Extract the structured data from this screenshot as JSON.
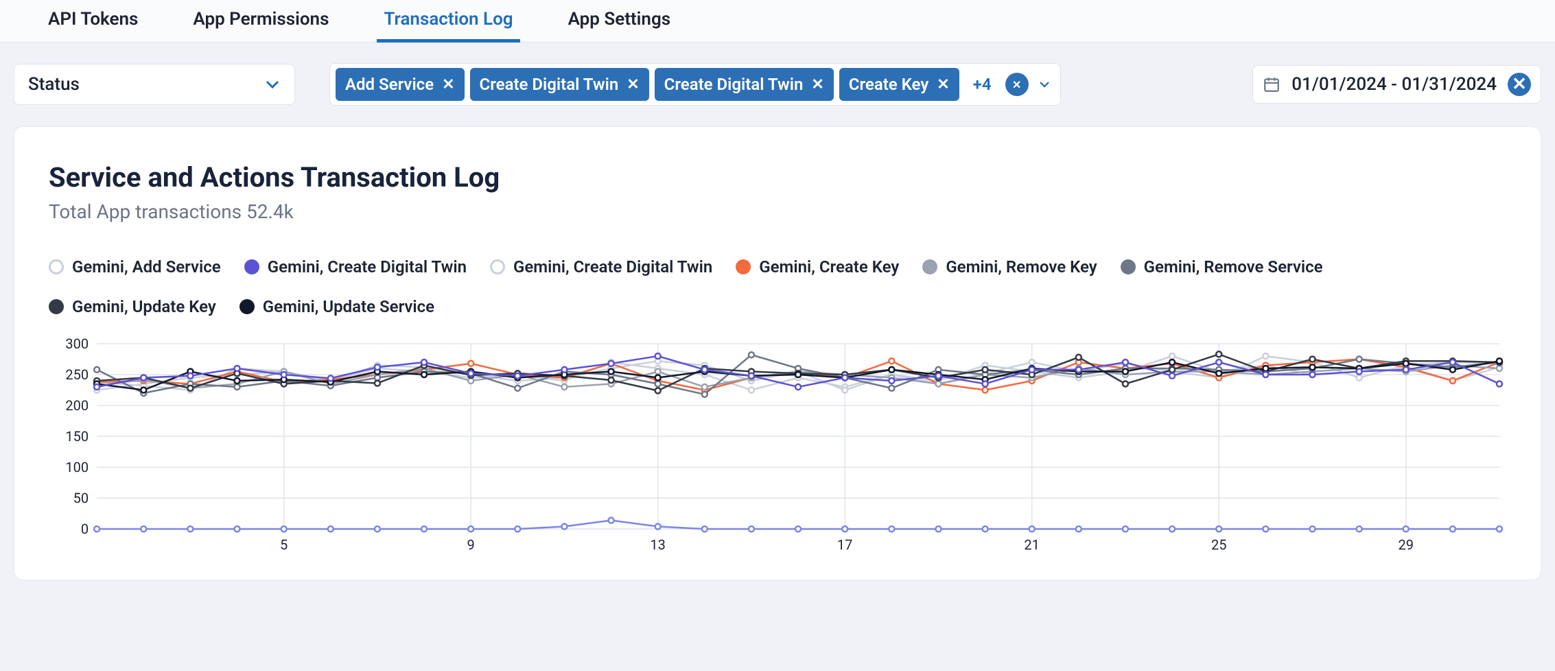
{
  "tabs": [
    {
      "label": "API Tokens",
      "active": false
    },
    {
      "label": "App Permissions",
      "active": false
    },
    {
      "label": "Transaction Log",
      "active": true
    },
    {
      "label": "App Settings",
      "active": false
    }
  ],
  "status_filter": {
    "label": "Status"
  },
  "chips": [
    {
      "label": "Add Service"
    },
    {
      "label": "Create Digital Twin"
    },
    {
      "label": "Create Digital Twin"
    },
    {
      "label": "Create Key"
    }
  ],
  "chips_more": "+4",
  "date_range": {
    "label": "01/01/2024 - 01/31/2024"
  },
  "card": {
    "title": "Service and Actions Transaction Log",
    "subtitle": "Total App transactions 52.4k"
  },
  "legend": [
    {
      "label": "Gemini, Add Service",
      "color": "#c9cfdb",
      "filled": false
    },
    {
      "label": "Gemini, Create Digital Twin",
      "color": "#5b52d6",
      "filled": true
    },
    {
      "label": "Gemini, Create Digital Twin",
      "color": "#c9cfdb",
      "filled": false
    },
    {
      "label": "Gemini, Create Key",
      "color": "#f26a3d",
      "filled": true
    },
    {
      "label": "Gemini, Remove Key",
      "color": "#9aa2b1",
      "filled": true
    },
    {
      "label": "Gemini, Remove Service",
      "color": "#6e7787",
      "filled": true
    },
    {
      "label": "Gemini, Update Key",
      "color": "#343a46",
      "filled": true
    },
    {
      "label": "Gemini, Update Service",
      "color": "#12182b",
      "filled": true
    }
  ],
  "chart_data": {
    "type": "line",
    "xlabel": "",
    "ylabel": "",
    "ylim": [
      0,
      300
    ],
    "y_ticks": [
      0,
      50,
      100,
      150,
      200,
      250,
      300
    ],
    "x_tick_labels": [
      "5",
      "9",
      "13",
      "17",
      "21",
      "25",
      "29"
    ],
    "x_tick_positions": [
      5,
      9,
      13,
      17,
      21,
      25,
      29
    ],
    "x": [
      1,
      2,
      3,
      4,
      5,
      6,
      7,
      8,
      9,
      10,
      11,
      12,
      13,
      14,
      15,
      16,
      17,
      18,
      19,
      20,
      21,
      22,
      23,
      24,
      25,
      26,
      27,
      28,
      29,
      30,
      31
    ],
    "series": [
      {
        "name": "Gemini, Add Service",
        "color": "#c9cfdb",
        "values": [
          225,
          235,
          245,
          250,
          255,
          240,
          260,
          255,
          245,
          250,
          240,
          270,
          260,
          250,
          225,
          245,
          230,
          250,
          240,
          265,
          255,
          245,
          255,
          280,
          255,
          265,
          250,
          255,
          260,
          240,
          262
        ]
      },
      {
        "name": "Gemini, Create Digital Twin (flat)",
        "color": "#7c86e6",
        "values": [
          0,
          0,
          0,
          0,
          0,
          0,
          0,
          0,
          0,
          0,
          4,
          14,
          4,
          0,
          0,
          0,
          0,
          0,
          0,
          0,
          0,
          0,
          0,
          0,
          0,
          0,
          0,
          0,
          0,
          0,
          0
        ]
      },
      {
        "name": "Gemini, Create Digital Twin (2)",
        "color": "#c9cfdb",
        "values": [
          238,
          232,
          225,
          260,
          255,
          240,
          265,
          262,
          250,
          240,
          245,
          260,
          272,
          265,
          240,
          255,
          225,
          250,
          235,
          252,
          270,
          255,
          268,
          255,
          245,
          280,
          270,
          245,
          265,
          270,
          268
        ]
      },
      {
        "name": "Gemini, Create Key",
        "color": "#f26a3d",
        "values": [
          238,
          240,
          235,
          255,
          238,
          242,
          250,
          258,
          268,
          250,
          245,
          268,
          240,
          225,
          245,
          255,
          245,
          272,
          235,
          225,
          240,
          270,
          260,
          268,
          245,
          265,
          270,
          275,
          262,
          240,
          270
        ]
      },
      {
        "name": "Gemini, Remove Key",
        "color": "#9aa2b1",
        "values": [
          232,
          242,
          228,
          235,
          255,
          235,
          250,
          260,
          240,
          250,
          230,
          235,
          255,
          230,
          245,
          255,
          250,
          245,
          235,
          250,
          245,
          260,
          250,
          255,
          255,
          250,
          255,
          260,
          255,
          265,
          260
        ]
      },
      {
        "name": "Gemini, Remove Service",
        "color": "#6e7787",
        "values": [
          258,
          220,
          235,
          230,
          240,
          232,
          245,
          255,
          252,
          228,
          255,
          250,
          235,
          218,
          282,
          260,
          245,
          228,
          258,
          250,
          258,
          250,
          260,
          260,
          258,
          255,
          260,
          275,
          268,
          262,
          270
        ]
      },
      {
        "name": "Gemini, Update Key",
        "color": "#343a46",
        "values": [
          240,
          245,
          228,
          252,
          235,
          240,
          236,
          265,
          249,
          252,
          248,
          241,
          224,
          260,
          255,
          252,
          250,
          258,
          245,
          258,
          250,
          278,
          235,
          258,
          283,
          255,
          275,
          260,
          272,
          272,
          270
        ]
      },
      {
        "name": "Gemini, Update Service",
        "color": "#12182b",
        "values": [
          235,
          225,
          255,
          240,
          242,
          238,
          255,
          250,
          255,
          245,
          250,
          255,
          245,
          255,
          248,
          250,
          245,
          258,
          250,
          242,
          260,
          255,
          255,
          270,
          252,
          260,
          262,
          260,
          268,
          258,
          272
        ]
      },
      {
        "name": "Gemini, Create Digital Twin (purple)",
        "color": "#5b52d6",
        "values": [
          230,
          245,
          248,
          260,
          250,
          244,
          262,
          270,
          252,
          248,
          258,
          268,
          280,
          258,
          248,
          230,
          245,
          240,
          248,
          235,
          258,
          258,
          270,
          248,
          270,
          250,
          250,
          255,
          258,
          270,
          235
        ]
      }
    ]
  }
}
